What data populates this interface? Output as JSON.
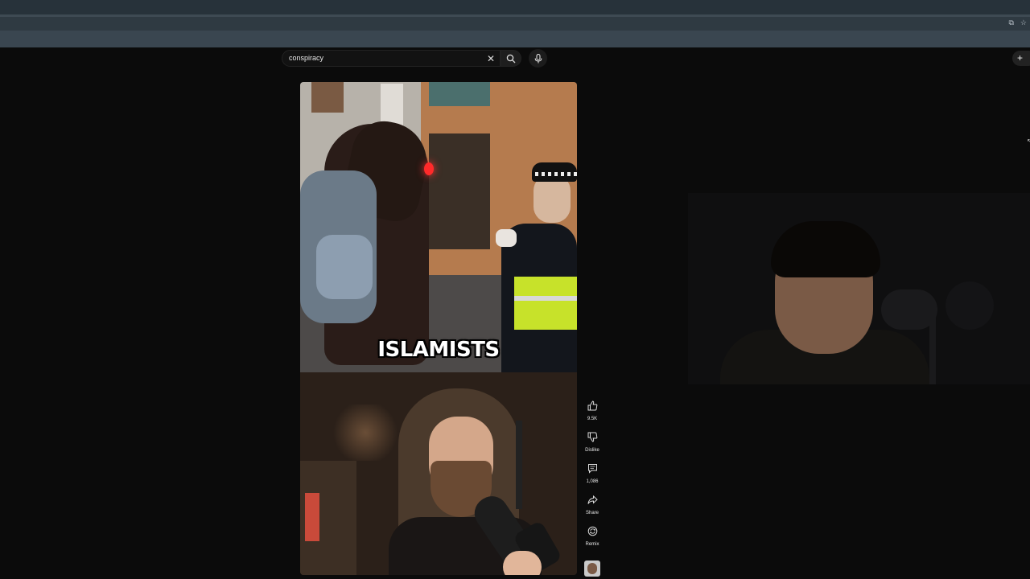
{
  "search": {
    "query": "conspiracy"
  },
  "video": {
    "caption": "ISLAMISTS"
  },
  "actions": {
    "like_count": "9.5K",
    "dislike_label": "Dislike",
    "comment_count": "1,086",
    "share_label": "Share",
    "remix_label": "Remix"
  },
  "icons": {
    "clear": "close-icon",
    "search": "search-icon",
    "mic": "microphone-icon",
    "create": "plus-icon",
    "like": "thumbs-up-icon",
    "dislike": "thumbs-down-icon",
    "comment": "comment-icon",
    "share": "share-icon",
    "remix": "remix-icon"
  },
  "colors": {
    "background": "#0b0b0b",
    "chrome": "#27323a"
  }
}
